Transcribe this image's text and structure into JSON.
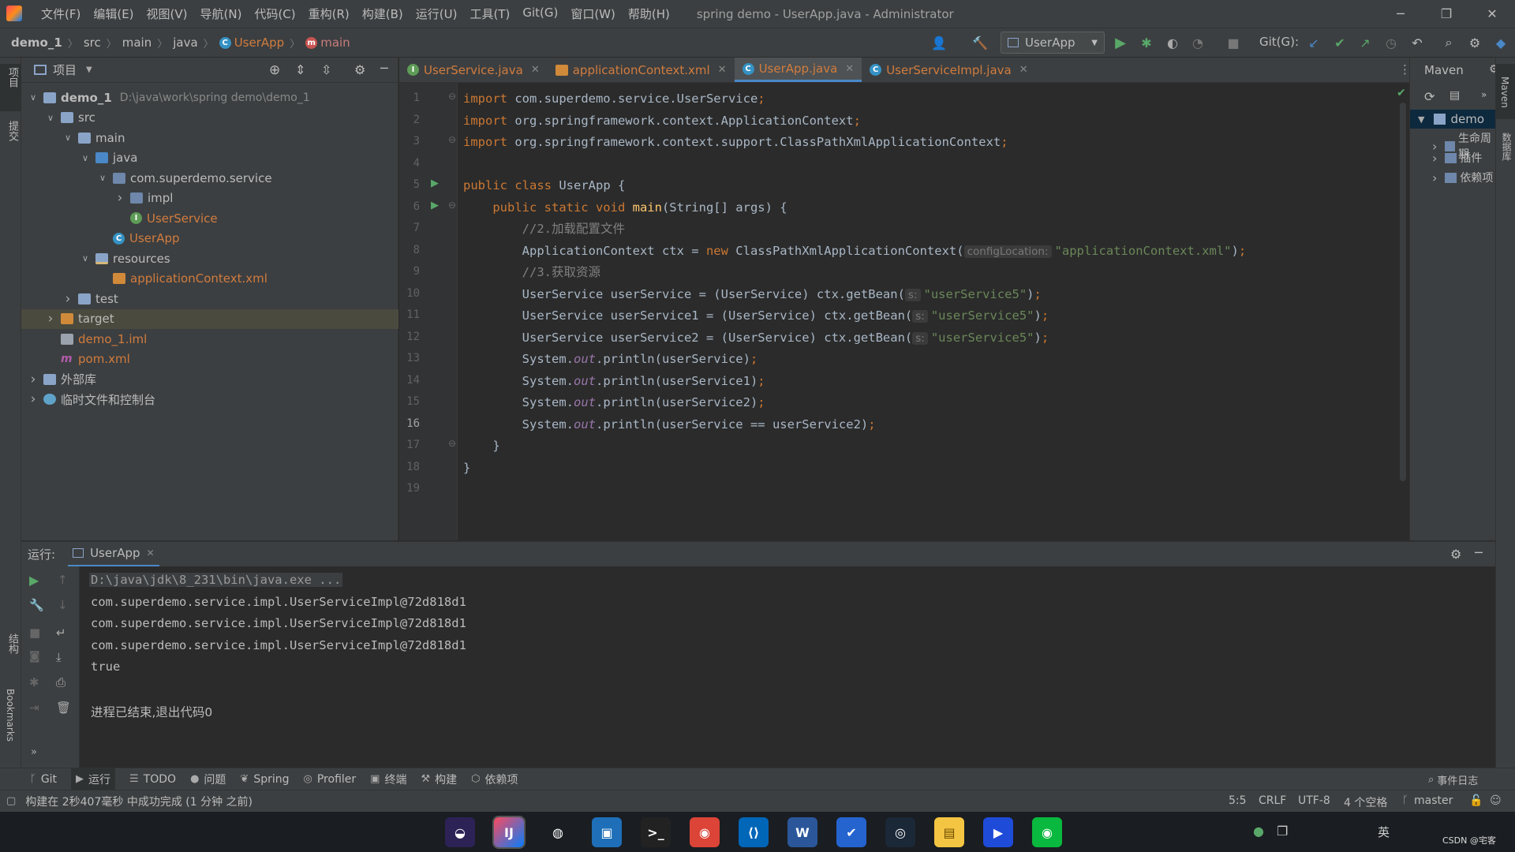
{
  "window": {
    "title": "spring demo - UserApp.java - Administrator",
    "menu": [
      "文件(F)",
      "编辑(E)",
      "视图(V)",
      "导航(N)",
      "代码(C)",
      "重构(R)",
      "构建(B)",
      "运行(U)",
      "工具(T)",
      "Git(G)",
      "窗口(W)",
      "帮助(H)"
    ]
  },
  "breadcrumb": [
    "demo_1",
    "src",
    "main",
    "java",
    "UserApp",
    "main"
  ],
  "toolbar": {
    "run_config": "UserApp",
    "git_label": "Git(G):"
  },
  "left_strip": {
    "project_label": "项目",
    "commit_label": "提交",
    "structure_label": "结构",
    "bookmarks_label": "Bookmarks"
  },
  "project_panel": {
    "title": "项目",
    "tree": [
      {
        "label": "demo_1",
        "path": "D:\\java\\work\\spring demo\\demo_1",
        "icon": "module-folder-icon",
        "depth": 0,
        "expanded": true,
        "color": "#bbbbbb"
      },
      {
        "label": "src",
        "icon": "folder-icon",
        "depth": 1,
        "expanded": true,
        "color": "#bbbbbb"
      },
      {
        "label": "main",
        "icon": "folder-icon",
        "depth": 2,
        "expanded": true,
        "color": "#bbbbbb"
      },
      {
        "label": "java",
        "icon": "source-folder-icon",
        "depth": 3,
        "expanded": true,
        "color": "#bbbbbb"
      },
      {
        "label": "com.superdemo.service",
        "icon": "package-icon",
        "depth": 4,
        "expanded": true,
        "color": "#bbbbbb"
      },
      {
        "label": "impl",
        "icon": "package-icon",
        "depth": 5,
        "expanded": false,
        "color": "#bbbbbb"
      },
      {
        "label": "UserService",
        "icon": "interface-icon",
        "depth": 5,
        "expanded": null,
        "color": "#d17c3e"
      },
      {
        "label": "UserApp",
        "icon": "class-icon",
        "depth": 4,
        "expanded": null,
        "color": "#d17c3e"
      },
      {
        "label": "resources",
        "icon": "resources-folder-icon",
        "depth": 3,
        "expanded": true,
        "color": "#bbbbbb"
      },
      {
        "label": "applicationContext.xml",
        "icon": "xml-file-icon",
        "depth": 4,
        "expanded": null,
        "color": "#d17c3e"
      },
      {
        "label": "test",
        "icon": "folder-icon",
        "depth": 2,
        "expanded": false,
        "color": "#bbbbbb"
      },
      {
        "label": "target",
        "icon": "excluded-folder-icon",
        "depth": 1,
        "expanded": false,
        "color": "#bbbbbb"
      },
      {
        "label": "demo_1.iml",
        "icon": "iml-file-icon",
        "depth": 1,
        "expanded": null,
        "color": "#d17c3e"
      },
      {
        "label": "pom.xml",
        "icon": "maven-file-icon",
        "depth": 1,
        "expanded": null,
        "color": "#d17c3e"
      },
      {
        "label": "外部库",
        "icon": "library-icon",
        "depth": 0,
        "expanded": false,
        "color": "#bbbbbb"
      },
      {
        "label": "临时文件和控制台",
        "icon": "scratches-icon",
        "depth": 0,
        "expanded": false,
        "color": "#bbbbbb"
      }
    ]
  },
  "tabs": [
    {
      "label": "UserService.java",
      "icon": "interface-icon",
      "active": false,
      "color": "#d17c3e"
    },
    {
      "label": "applicationContext.xml",
      "icon": "xml-file-icon",
      "active": false,
      "color": "#d17c3e"
    },
    {
      "label": "UserApp.java",
      "icon": "class-icon",
      "active": true,
      "color": "#d17c3e"
    },
    {
      "label": "UserServiceImpl.java",
      "icon": "class-icon",
      "active": false,
      "color": "#d17c3e"
    }
  ],
  "editor": {
    "current_line": 16,
    "lines": [
      [
        [
          "kw",
          "import "
        ],
        [
          "p",
          "com.superdemo.service.UserService"
        ],
        [
          "kw",
          ";"
        ]
      ],
      [
        [
          "kw",
          "import "
        ],
        [
          "p",
          "org.springframework.context.ApplicationContext"
        ],
        [
          "kw",
          ";"
        ]
      ],
      [
        [
          "kw",
          "import "
        ],
        [
          "p",
          "org.springframework.context.support.ClassPathXmlApplicationContext"
        ],
        [
          "kw",
          ";"
        ]
      ],
      [],
      [
        [
          "kw",
          "public class "
        ],
        [
          "p",
          "UserApp {"
        ]
      ],
      [
        [
          "p",
          "    "
        ],
        [
          "kw",
          "public static void "
        ],
        [
          "fn",
          "main"
        ],
        [
          "p",
          "(String[] args) {"
        ]
      ],
      [
        [
          "p",
          "        "
        ],
        [
          "cm",
          "//2.加载配置文件"
        ]
      ],
      [
        [
          "p",
          "        ApplicationContext ctx = "
        ],
        [
          "kw",
          "new "
        ],
        [
          "p",
          "ClassPathXmlApplicationContext("
        ],
        [
          "hint",
          "configLocation:"
        ],
        [
          "str",
          "\"applicationContext.xml\""
        ],
        [
          "p",
          ")"
        ],
        [
          "kw",
          ";"
        ]
      ],
      [
        [
          "p",
          "        "
        ],
        [
          "cm",
          "//3.获取资源"
        ]
      ],
      [
        [
          "p",
          "        UserService userService = (UserService) ctx.getBean("
        ],
        [
          "hint",
          "s:"
        ],
        [
          "str",
          "\"userService5\""
        ],
        [
          "p",
          ")"
        ],
        [
          "kw",
          ";"
        ]
      ],
      [
        [
          "p",
          "        UserService userService1 = (UserService) ctx.getBean("
        ],
        [
          "hint",
          "s:"
        ],
        [
          "str",
          "\"userService5\""
        ],
        [
          "p",
          ")"
        ],
        [
          "kw",
          ";"
        ]
      ],
      [
        [
          "p",
          "        UserService userService2 = (UserService) ctx.getBean("
        ],
        [
          "hint",
          "s:"
        ],
        [
          "str",
          "\"userService5\""
        ],
        [
          "p",
          ")"
        ],
        [
          "kw",
          ";"
        ]
      ],
      [
        [
          "p",
          "        System."
        ],
        [
          "it",
          "out"
        ],
        [
          "p",
          ".println(userService)"
        ],
        [
          "kw",
          ";"
        ]
      ],
      [
        [
          "p",
          "        System."
        ],
        [
          "it",
          "out"
        ],
        [
          "p",
          ".println(userService1)"
        ],
        [
          "kw",
          ";"
        ]
      ],
      [
        [
          "p",
          "        System."
        ],
        [
          "it",
          "out"
        ],
        [
          "p",
          ".println(userService2)"
        ],
        [
          "kw",
          ";"
        ]
      ],
      [
        [
          "p",
          "        System."
        ],
        [
          "it",
          "out"
        ],
        [
          "p",
          ".println(userService == userService2)"
        ],
        [
          "kw",
          ";"
        ]
      ],
      [
        [
          "p",
          "    }"
        ]
      ],
      [
        [
          "p",
          "}"
        ]
      ],
      []
    ]
  },
  "maven": {
    "title": "Maven",
    "root": "demo",
    "items": [
      "生命周期",
      "插件",
      "依赖项"
    ],
    "side_label": "Maven",
    "db_label": "数据库"
  },
  "run": {
    "label": "运行:",
    "tab": "UserApp",
    "output": [
      "D:\\java\\jdk\\8_231\\bin\\java.exe ...",
      "com.superdemo.service.impl.UserServiceImpl@72d818d1",
      "com.superdemo.service.impl.UserServiceImpl@72d818d1",
      "com.superdemo.service.impl.UserServiceImpl@72d818d1",
      "true",
      "",
      "进程已结束,退出代码0"
    ]
  },
  "bottom_tools": [
    {
      "label": "Git",
      "icon": "git-branch-icon"
    },
    {
      "label": "运行",
      "icon": "run-icon"
    },
    {
      "label": "TODO",
      "icon": "list-icon"
    },
    {
      "label": "问题",
      "icon": "problems-icon"
    },
    {
      "label": "Spring",
      "icon": "spring-icon"
    },
    {
      "label": "Profiler",
      "icon": "profiler-icon"
    },
    {
      "label": "终端",
      "icon": "terminal-icon"
    },
    {
      "label": "构建",
      "icon": "hammer-icon"
    },
    {
      "label": "依赖项",
      "icon": "dependencies-icon"
    }
  ],
  "event_log": "事件日志",
  "status": {
    "message": "构建在 2秒407毫秒 中成功完成 (1 分钟 之前)",
    "position": "5:5",
    "line_sep": "CRLF",
    "encoding": "UTF-8",
    "indent": "4 个空格",
    "branch": "master"
  },
  "taskbar": {
    "apps": [
      "eclipse-icon",
      "intellij-icon",
      "browser-icon",
      "remote-desktop-icon",
      "terminal-icon",
      "chrome-icon",
      "vscode-icon",
      "word-icon",
      "todo-icon",
      "steam-icon",
      "file-explorer-icon",
      "video-icon",
      "wechat-icon"
    ],
    "ime": "英",
    "corner_text": "CSDN @宅客"
  }
}
